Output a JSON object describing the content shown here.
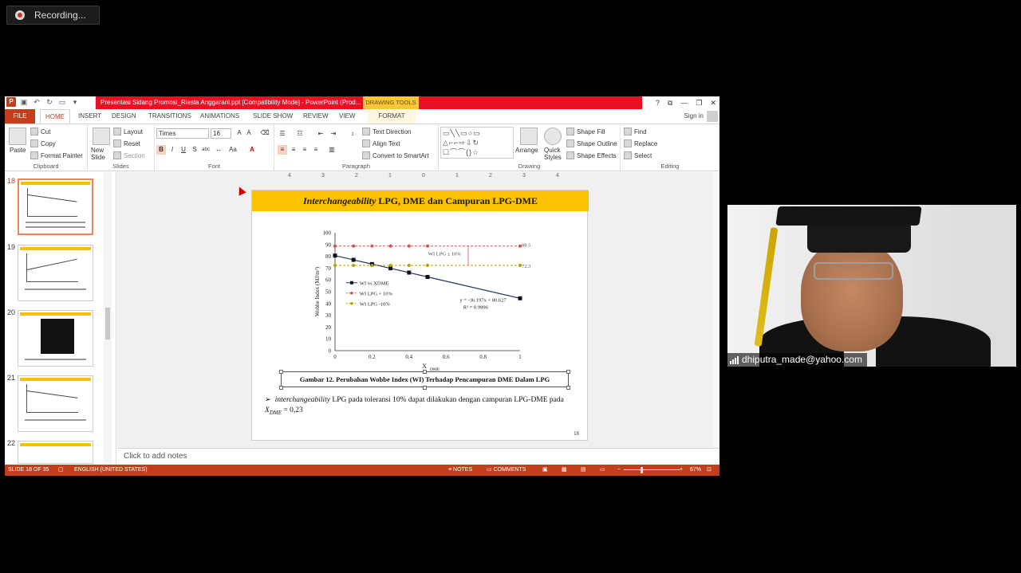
{
  "recording": {
    "label": "Recording..."
  },
  "window": {
    "title": "Presentasi Sidang Promosi_Riesta Anggarani.ppt [Compatibility Mode] - PowerPoint (Prod...",
    "drawing_tools": "DRAWING TOOLS",
    "controls": [
      "?",
      "⧉",
      "—",
      "❐",
      "✕"
    ]
  },
  "tabs": [
    "FILE",
    "HOME",
    "INSERT",
    "DESIGN",
    "TRANSITIONS",
    "ANIMATIONS",
    "SLIDE SHOW",
    "REVIEW",
    "VIEW",
    "FORMAT"
  ],
  "signin": "Sign in",
  "ribbon": {
    "clipboard": {
      "paste": "Paste",
      "cut": "Cut",
      "copy": "Copy",
      "format_painter": "Format Painter",
      "label": "Clipboard"
    },
    "slides": {
      "new_slide": "New Slide",
      "layout": "Layout",
      "reset": "Reset",
      "section": "Section",
      "label": "Slides"
    },
    "font": {
      "name": "Times",
      "size": "16",
      "label": "Font"
    },
    "paragraph": {
      "text_direction": "Text Direction",
      "align_text": "Align Text",
      "convert_smartart": "Convert to SmartArt",
      "label": "Paragraph"
    },
    "drawing": {
      "arrange": "Arrange",
      "quick_styles": "Quick Styles",
      "shape_fill": "Shape Fill",
      "shape_outline": "Shape Outline",
      "shape_effects": "Shape Effects",
      "label": "Drawing"
    },
    "editing": {
      "find": "Find",
      "replace": "Replace",
      "select": "Select",
      "label": "Editing"
    }
  },
  "thumbnails": [
    {
      "num": "18",
      "kind": "chart",
      "active": true
    },
    {
      "num": "19",
      "kind": "chart",
      "active": false
    },
    {
      "num": "20",
      "kind": "image",
      "active": false
    },
    {
      "num": "21",
      "kind": "chart",
      "active": false
    },
    {
      "num": "22",
      "kind": "chart",
      "active": false
    }
  ],
  "ruler": [
    "4",
    "3",
    "2",
    "1",
    "0",
    "1",
    "2",
    "3",
    "4"
  ],
  "slide": {
    "title_italic": "Interchangeability",
    "title_rest": " LPG, DME dan Campuran LPG-DME",
    "caption": "Gambar 12. Perubahan Wobbe Index (WI) Terhadap Pencampuran DME Dalam LPG",
    "bullet_italic": "interchangeability",
    "bullet_rest": " LPG pada toleransi 10% dapat dilakukan dengan campuran LPG-DME pada ",
    "bullet_x": "X",
    "bullet_sub": "DME",
    "bullet_end": " = 0,23",
    "number": "18"
  },
  "chart_data": {
    "type": "line",
    "x": [
      0,
      0.1,
      0.2,
      0.3,
      0.4,
      0.5,
      1
    ],
    "series": [
      {
        "name": "WI vs XDME",
        "values": [
          80.6,
          77.0,
          73.4,
          69.8,
          66.2,
          62.5,
          44.4
        ],
        "color": "#1f3864",
        "marker": "square"
      },
      {
        "name": "WI LPG + 10%",
        "values": [
          88.7,
          88.7,
          88.7,
          88.7,
          88.7,
          88.7,
          88.7
        ],
        "color": "#d9534f",
        "marker": "circle"
      },
      {
        "name": "WI LPG -10%",
        "values": [
          72.3,
          72.3,
          72.3,
          72.3,
          72.3,
          72.3,
          72.3
        ],
        "color": "#b8a000",
        "marker": "circle"
      }
    ],
    "xlabel": "X",
    "xlabel_sub": "DME",
    "ylabel": "Wobbe Index (MJ/m³)",
    "xlim": [
      0,
      1
    ],
    "ylim": [
      0,
      100
    ],
    "xticks": [
      "0",
      "0.2",
      "0.4",
      "0.6",
      "0.8",
      "1"
    ],
    "yticks": [
      "0",
      "10",
      "20",
      "30",
      "40",
      "50",
      "60",
      "70",
      "80",
      "90",
      "100"
    ],
    "annotations": {
      "upper": "88.5",
      "lower": "72.3",
      "band": "WI LPG ± 10%",
      "equation": "y = -36.197x + 80.627",
      "r2": "R² = 0.9996"
    },
    "legend_placement": "left"
  },
  "notes": "Click to add notes",
  "status": {
    "slide": "SLIDE 18 OF 35",
    "language": "ENGLISH (UNITED STATES)",
    "notes": "NOTES",
    "comments": "COMMENTS",
    "zoom": "67%"
  },
  "webcam": {
    "name": "dhiputra_made@yahoo.com"
  }
}
